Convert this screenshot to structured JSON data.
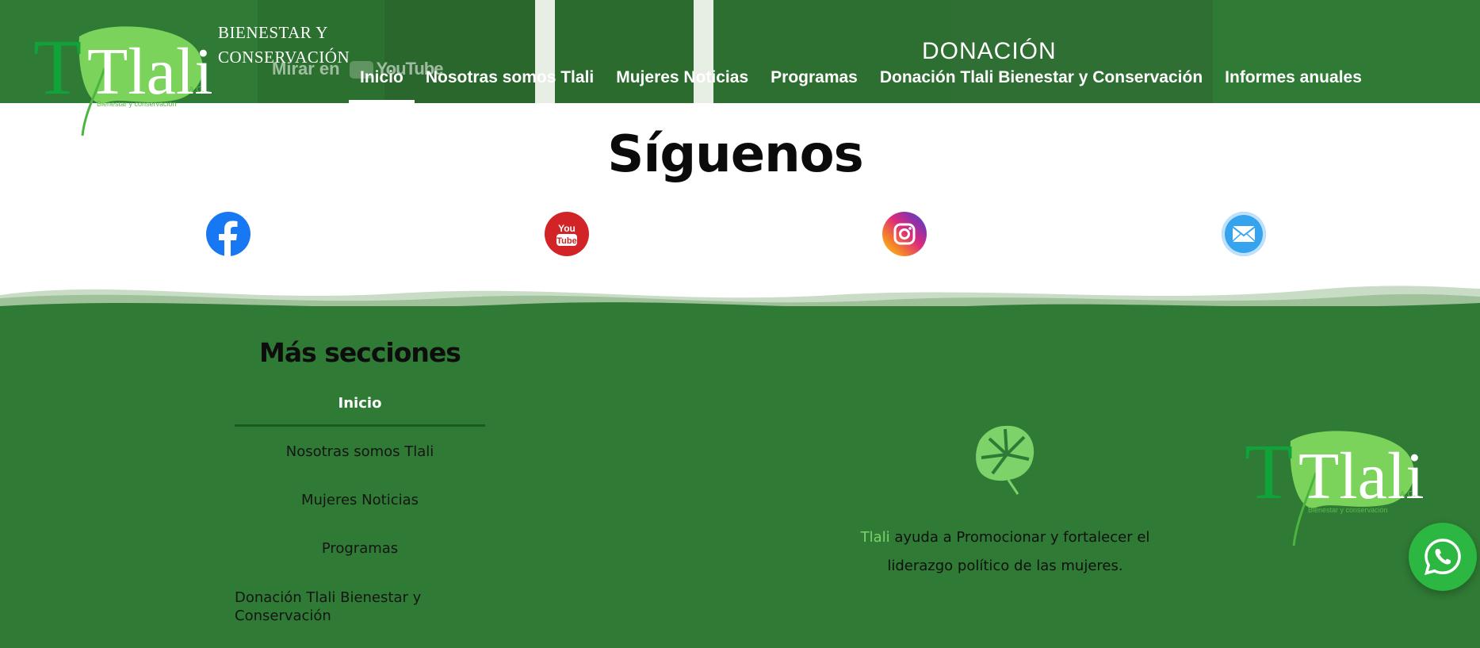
{
  "header": {
    "brand": {
      "logo_text": "Tlali",
      "tagline_line1": "BIENESTAR Y",
      "tagline_line2": "CONSERVACIÓN"
    },
    "video_overlay": {
      "watch_label": "Mirar en",
      "platform": "YouTube"
    },
    "donation_heading": "DONACIÓN",
    "nav": [
      {
        "label": "Inicio",
        "active": true
      },
      {
        "label": "Nosotras somos Tlali",
        "active": false
      },
      {
        "label": "Mujeres Noticias",
        "active": false
      },
      {
        "label": "Programas",
        "active": false
      },
      {
        "label": "Donación Tlali Bienestar y Conservación",
        "active": false
      },
      {
        "label": "Informes anuales",
        "active": false
      }
    ]
  },
  "follow": {
    "title": "Síguenos",
    "social": [
      {
        "icon": "facebook-icon",
        "color": "#1877f2"
      },
      {
        "icon": "youtube-icon",
        "color": "#d22327"
      },
      {
        "icon": "instagram-icon",
        "color": "#dd2a7b"
      },
      {
        "icon": "mail-icon",
        "color": "#35a3ee"
      }
    ]
  },
  "footer": {
    "more_sections": {
      "title": "Más secciones",
      "items": [
        {
          "label": "Inicio",
          "active": true
        },
        {
          "label": "Nosotras somos Tlali",
          "active": false
        },
        {
          "label": "Mujeres Noticias",
          "active": false
        },
        {
          "label": "Programas",
          "active": false
        },
        {
          "label": "Donación Tlali Bienestar y Conservación",
          "active": false
        }
      ]
    },
    "mission": {
      "brand_word": "Tlali",
      "text": "ayuda a Promocionar y fortalecer el liderazgo político de las mujeres."
    },
    "logo_text": "Tlali"
  },
  "colors": {
    "brand_green": "#2f7a34",
    "leaf_green": "#7dd36a",
    "whatsapp_green": "#2bb741"
  }
}
